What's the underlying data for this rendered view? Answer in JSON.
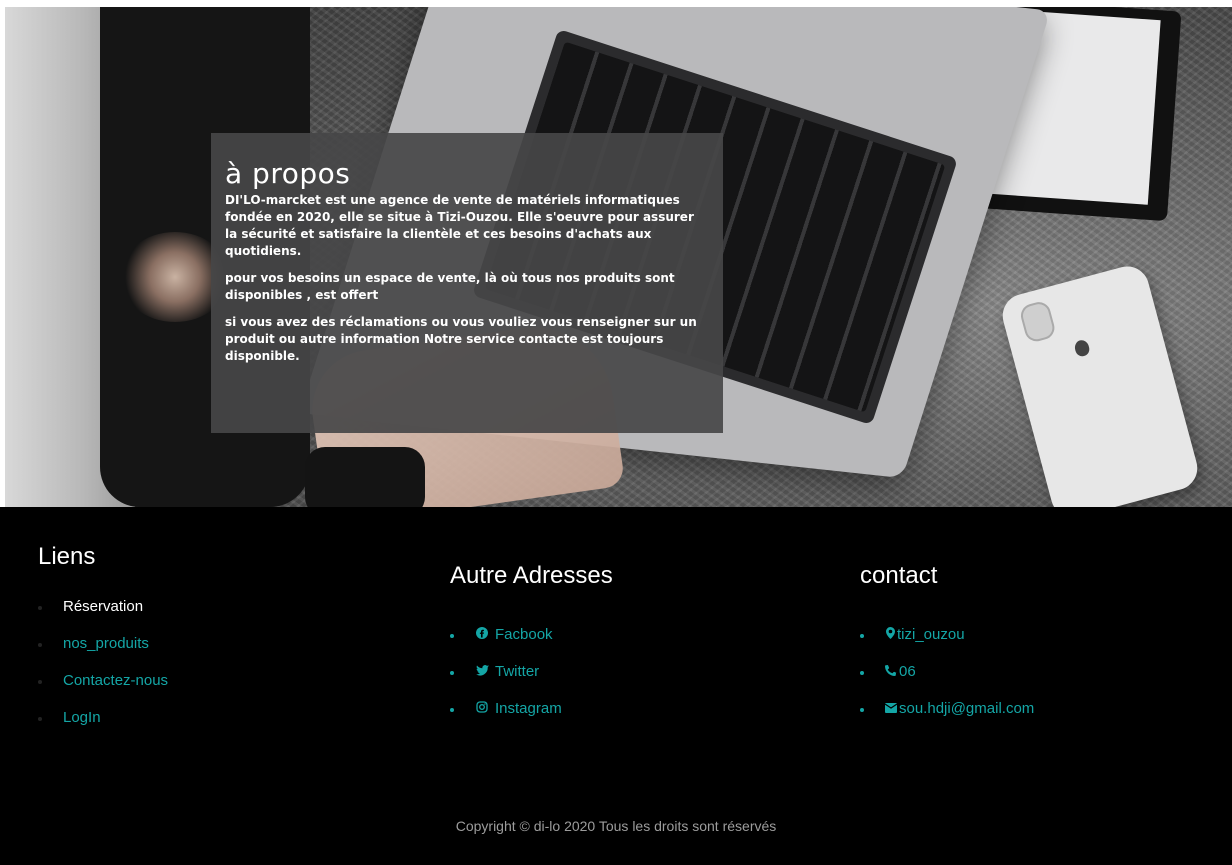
{
  "about": {
    "title": "à propos",
    "paragraphs": [
      "DI'LO-marcket est une agence de vente de matériels informatiques fondée en 2020, elle se situe à Tizi-Ouzou. Elle s'oeuvre pour assurer la sécurité et satisfaire la clientèle et ces besoins d'achats aux quotidiens.",
      "pour vos besoins un espace de vente, là où tous nos produits sont disponibles , est offert",
      "si vous avez des réclamations ou vous vouliez vous renseigner sur un produit ou autre information Notre service contacte est toujours disponible."
    ]
  },
  "footer": {
    "liens": {
      "title": "Liens",
      "items": [
        "Réservation",
        "nos_produits",
        "Contactez-nous",
        "LogIn"
      ]
    },
    "adresses": {
      "title": "Autre Adresses",
      "items": [
        {
          "icon": "facebook-icon",
          "label": "Facbook"
        },
        {
          "icon": "twitter-icon",
          "label": "Twitter"
        },
        {
          "icon": "instagram-icon",
          "label": "Instagram"
        }
      ]
    },
    "contact": {
      "title": "contact",
      "items": [
        {
          "icon": "map-marker-icon",
          "label": "tizi_ouzou"
        },
        {
          "icon": "phone-icon",
          "label": "06"
        },
        {
          "icon": "envelope-icon",
          "label": "sou.hdji@gmail.com"
        }
      ]
    },
    "copyright": "Copyright © di-lo 2020 Tous les droits sont réservés"
  },
  "colors": {
    "accent": "#14a6a6",
    "footer_bg": "#000000",
    "about_bg": "#464648"
  }
}
